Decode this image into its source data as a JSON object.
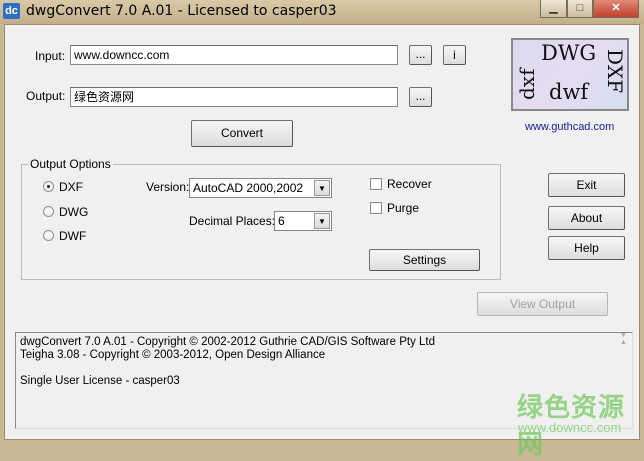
{
  "window": {
    "title": "dwgConvert 7.0 A.01 - Licensed to casper03",
    "icon_text": "dc"
  },
  "input": {
    "label": "Input:",
    "value": "www.downcc.com",
    "browse_label": "...",
    "info_label": "i"
  },
  "output": {
    "label": "Output:",
    "value": "绿色资源网",
    "browse_label": "..."
  },
  "convert_label": "Convert",
  "logo": {
    "dwg": "DWG",
    "dxf_upper": "DXF",
    "dxf_lower": "dxf",
    "dwf": "dwf"
  },
  "link": "www.guthcad.com",
  "options": {
    "title": "Output Options",
    "formats": [
      {
        "label": "DXF",
        "selected": true
      },
      {
        "label": "DWG",
        "selected": false
      },
      {
        "label": "DWF",
        "selected": false
      }
    ],
    "version_label": "Version:",
    "version_value": "AutoCAD 2000,2002",
    "decimal_label": "Decimal Places:",
    "decimal_value": "6",
    "recover_label": "Recover",
    "purge_label": "Purge",
    "settings_label": "Settings"
  },
  "side": {
    "exit": "Exit",
    "about": "About",
    "help": "Help"
  },
  "view_output_label": "View Output",
  "log": [
    "dwgConvert 7.0 A.01 - Copyright © 2002-2012 Guthrie CAD/GIS Software Pty Ltd",
    "Teigha 3.08 - Copyright © 2003-2012, Open Design Alliance",
    "",
    "Single User License - casper03"
  ],
  "watermark": {
    "title": "绿色资源网",
    "url": "www.downcc.com"
  }
}
